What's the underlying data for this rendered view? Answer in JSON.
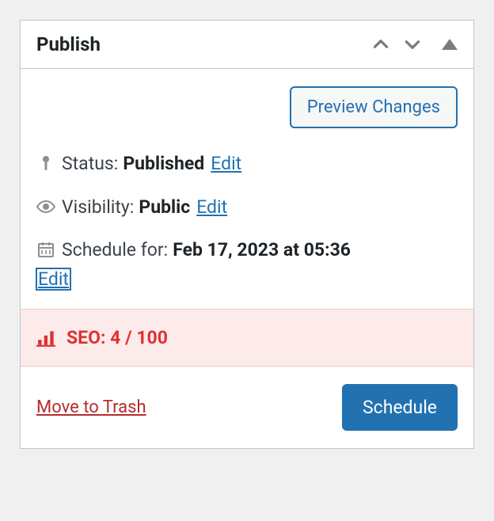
{
  "header": {
    "title": "Publish"
  },
  "preview_button": "Preview Changes",
  "status": {
    "label": "Status:",
    "value": "Published",
    "edit": "Edit"
  },
  "visibility": {
    "label": "Visibility:",
    "value": "Public",
    "edit": "Edit"
  },
  "schedule": {
    "label": "Schedule for:",
    "value": "Feb 17, 2023 at 05:36",
    "edit": "Edit"
  },
  "seo": {
    "text": "SEO: 4 / 100"
  },
  "footer": {
    "trash": "Move to Trash",
    "submit": "Schedule"
  }
}
